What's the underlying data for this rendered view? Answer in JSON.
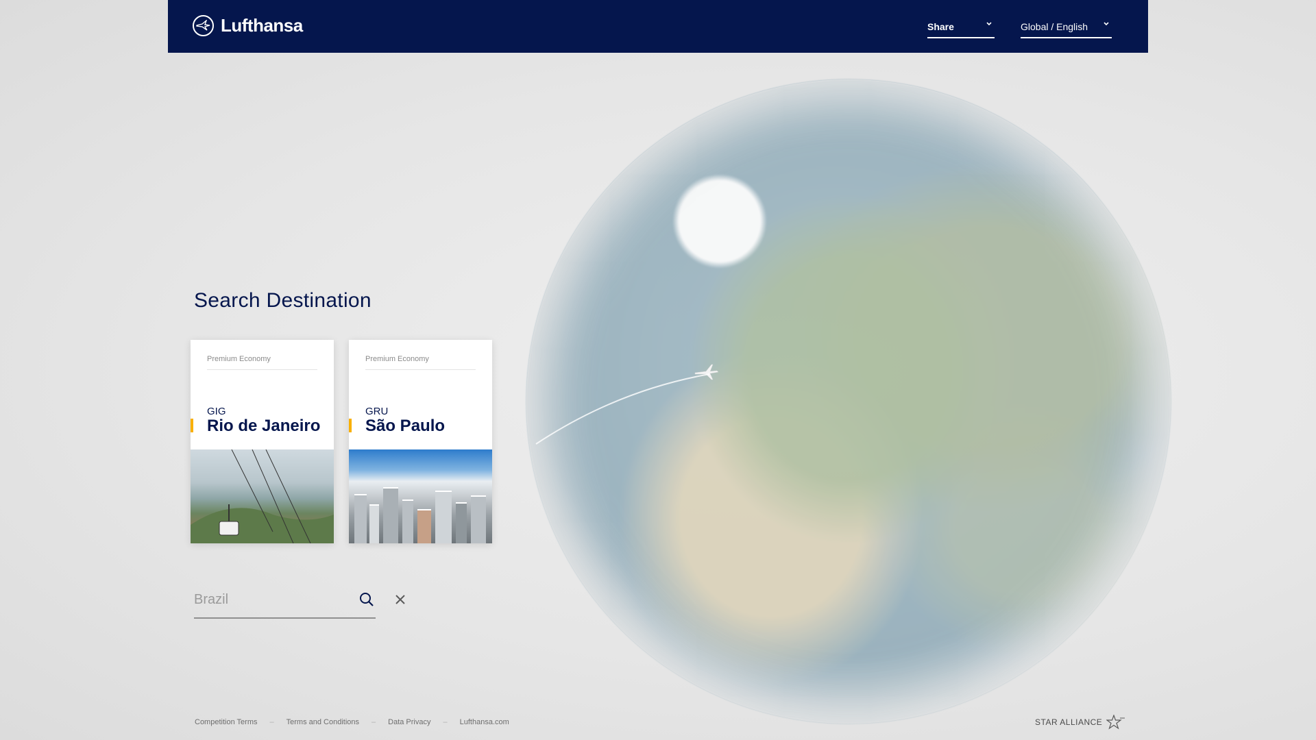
{
  "header": {
    "brand": "Lufthansa",
    "share_label": "Share",
    "language_label": "Global / English"
  },
  "main": {
    "title": "Search Destination",
    "destinations": [
      {
        "class_label": "Premium Economy",
        "code": "GIG",
        "city": "Rio de Janeiro"
      },
      {
        "class_label": "Premium Economy",
        "code": "GRU",
        "city": "São Paulo"
      }
    ],
    "search": {
      "value": "Brazil"
    }
  },
  "footer": {
    "links": [
      "Competition Terms",
      "Terms and Conditions",
      "Data Privacy",
      "Lufthansa.com"
    ],
    "partner": "STAR ALLIANCE"
  },
  "colors": {
    "brand_navy": "#05164d",
    "accent_yellow": "#f9b000"
  },
  "icons": [
    "lufthansa-crane-logo-icon",
    "chevron-down-icon",
    "search-icon",
    "close-icon",
    "airplane-icon",
    "star-alliance-icon"
  ]
}
